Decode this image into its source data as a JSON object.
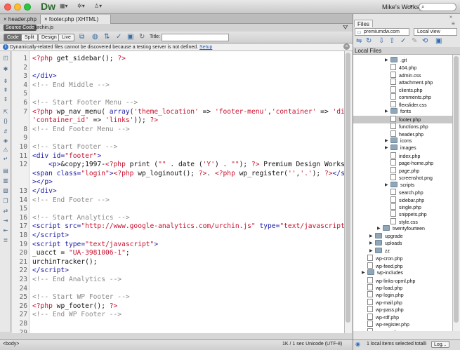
{
  "titlebar": {
    "app_logo": "Dw",
    "workspace": "Mike's Workspace",
    "search_placeholder": ""
  },
  "doc_tabs": [
    "header.php",
    "footer.php (XHTML)"
  ],
  "related": {
    "badge": "Source Code",
    "file": "urchin.js"
  },
  "view_buttons": [
    "Code",
    "Split",
    "Design",
    "Live"
  ],
  "title_label": "Title:",
  "info_bar": {
    "text": "Dynamically-related files cannot be discovered because a testing server is not defined.",
    "link": "Setup"
  },
  "code_lines": [
    {
      "n": "1",
      "html": "<span class='p'>&lt;?php</span> get_sidebar(); <span class='p'>?&gt;</span>"
    },
    {
      "n": "2",
      "html": ""
    },
    {
      "n": "3",
      "html": "<span class='t'>&lt;/div&gt;</span>"
    },
    {
      "n": "4",
      "html": "<span class='c'>&lt;!-- End Middle --&gt;</span>"
    },
    {
      "n": "5",
      "html": ""
    },
    {
      "n": "6",
      "html": "<span class='c'>&lt;!-- Start Footer Menu --&gt;</span>"
    },
    {
      "n": "7",
      "html": "<span class='p'>&lt;?php</span> wp_nav_menu( <span class='t'>array</span>(<span class='s'>'theme_location'</span> =&gt; <span class='s'>'footer-menu'</span>,<span class='s'>'container'</span> =&gt; <span class='s'>'div'</span>,"
    },
    {
      "n": "",
      "html": "<span class='s'>'container_id'</span> =&gt; <span class='s'>'links'</span>)); <span class='p'>?&gt;</span>"
    },
    {
      "n": "8",
      "html": "<span class='c'>&lt;!-- End Footer Menu --&gt;</span>"
    },
    {
      "n": "9",
      "html": ""
    },
    {
      "n": "10",
      "html": "<span class='c'>&lt;!-- Start Footer --&gt;</span>"
    },
    {
      "n": "11",
      "html": "<span class='t'>&lt;div</span> <span class='t'>id=</span><span class='s'>\"footer\"</span><span class='t'>&gt;</span>"
    },
    {
      "n": "12",
      "html": "    <span class='t'>&lt;p&gt;</span>&amp;copy;1997-<span class='p'>&lt;?php</span> print (<span class='s'>\"\"</span> . date (<span class='s'>'Y'</span>) . <span class='s'>\"\"</span>); <span class='p'>?&gt;</span> Premium Design Works."
    },
    {
      "n": "",
      "html": "<span class='t'>&lt;span</span> <span class='t'>class=</span><span class='s'>\"login\"</span><span class='t'>&gt;</span><span class='p'>&lt;?php</span> wp_loginout(); <span class='p'>?&gt;</span>. <span class='p'>&lt;?php</span> wp_register(<span class='s'>''</span>,<span class='s'>'.'</span>); <span class='p'>?&gt;</span><span class='t'>&lt;/span</span>"
    },
    {
      "n": "",
      "html": "<span class='t'>&gt;&lt;/p&gt;</span>"
    },
    {
      "n": "13",
      "html": "<span class='t'>&lt;/div&gt;</span>"
    },
    {
      "n": "14",
      "html": "<span class='c'>&lt;!-- End Footer --&gt;</span>"
    },
    {
      "n": "15",
      "html": ""
    },
    {
      "n": "16",
      "html": "<span class='c'>&lt;!-- Start Analytics --&gt;</span>"
    },
    {
      "n": "17",
      "html": "<span class='t'>&lt;script</span> <span class='t'>src=</span><span class='s'>\"http://www.google-analytics.com/urchin.js\"</span> <span class='t'>type=</span><span class='s'>\"text/javascript\"</span><span class='t'>&gt;</span>"
    },
    {
      "n": "18",
      "html": "<span class='t'>&lt;/script&gt;</span>"
    },
    {
      "n": "19",
      "html": "<span class='t'>&lt;script</span> <span class='t'>type=</span><span class='s'>\"text/javascript\"</span><span class='t'>&gt;</span>"
    },
    {
      "n": "20",
      "html": "_uacct = <span class='s'>\"UA-3981006-1\"</span>;"
    },
    {
      "n": "21",
      "html": "urchinTracker();"
    },
    {
      "n": "22",
      "html": "<span class='t'>&lt;/script&gt;</span>"
    },
    {
      "n": "23",
      "html": "<span class='c'>&lt;!-- End Analytics --&gt;</span>"
    },
    {
      "n": "24",
      "html": ""
    },
    {
      "n": "25",
      "html": "<span class='c'>&lt;!-- Start WP Footer --&gt;</span>"
    },
    {
      "n": "26",
      "html": "<span class='p'>&lt;?php</span> wp_footer(); <span class='p'>?&gt;</span>"
    },
    {
      "n": "27",
      "html": "<span class='c'>&lt;!-- End WP Footer --&gt;</span>"
    },
    {
      "n": "28",
      "html": ""
    },
    {
      "n": "29",
      "html": ""
    },
    {
      "n": "30",
      "html": "<span class='t'>&lt;/body&gt;</span>"
    },
    {
      "n": "31",
      "html": "<span class='t'>&lt;/html&gt;</span>"
    },
    {
      "n": "32",
      "html": ""
    }
  ],
  "status": {
    "tag": "<body>",
    "info": "1K / 1 sec  Unicode (UTF-8)"
  },
  "files_panel": {
    "tab": "Files",
    "site": "premiumdw.com",
    "view": "Local view",
    "header": "Local Files",
    "items": [
      {
        "label": ".git",
        "type": "folder",
        "depth": 3,
        "arrow": true
      },
      {
        "label": "404.php",
        "type": "file",
        "depth": 3
      },
      {
        "label": "admin.css",
        "type": "file",
        "depth": 3
      },
      {
        "label": "attachment.php",
        "type": "file",
        "depth": 3
      },
      {
        "label": "clients.php",
        "type": "file",
        "depth": 3
      },
      {
        "label": "comments.php",
        "type": "file",
        "depth": 3
      },
      {
        "label": "flexslider.css",
        "type": "file",
        "depth": 3
      },
      {
        "label": "fonts",
        "type": "folder",
        "depth": 3,
        "arrow": true
      },
      {
        "label": "footer.php",
        "type": "file",
        "depth": 3,
        "selected": true
      },
      {
        "label": "functions.php",
        "type": "file",
        "depth": 3
      },
      {
        "label": "header.php",
        "type": "file",
        "depth": 3
      },
      {
        "label": "icons",
        "type": "folder",
        "depth": 3,
        "arrow": true
      },
      {
        "label": "images",
        "type": "folder",
        "depth": 3,
        "arrow": true
      },
      {
        "label": "index.php",
        "type": "file",
        "depth": 3
      },
      {
        "label": "page-home.php",
        "type": "file",
        "depth": 3
      },
      {
        "label": "page.php",
        "type": "file",
        "depth": 3
      },
      {
        "label": "screenshot.png",
        "type": "file",
        "depth": 3
      },
      {
        "label": "scripts",
        "type": "folder",
        "depth": 3,
        "arrow": true
      },
      {
        "label": "search.php",
        "type": "file",
        "depth": 3
      },
      {
        "label": "sidebar.php",
        "type": "file",
        "depth": 3
      },
      {
        "label": "single.php",
        "type": "file",
        "depth": 3
      },
      {
        "label": "snippets.php",
        "type": "file",
        "depth": 3
      },
      {
        "label": "style.css",
        "type": "file",
        "depth": 3
      },
      {
        "label": "twentyfourteen",
        "type": "folder",
        "depth": 2,
        "arrow": true
      },
      {
        "label": "upgrade",
        "type": "folder",
        "depth": 1,
        "arrow": true
      },
      {
        "label": "uploads",
        "type": "folder",
        "depth": 1,
        "arrow": true
      },
      {
        "label": "zz",
        "type": "folder",
        "depth": 1,
        "arrow": true
      },
      {
        "label": "wp-cron.php",
        "type": "file",
        "depth": 0
      },
      {
        "label": "wp-feed.php",
        "type": "file",
        "depth": 0
      },
      {
        "label": "wp-includes",
        "type": "folder",
        "depth": 0,
        "arrow": true
      },
      {
        "label": "wp-links-opml.php",
        "type": "file",
        "depth": 0
      },
      {
        "label": "wp-load.php",
        "type": "file",
        "depth": 0
      },
      {
        "label": "wp-login.php",
        "type": "file",
        "depth": 0
      },
      {
        "label": "wp-mail.php",
        "type": "file",
        "depth": 0
      },
      {
        "label": "wp-pass.php",
        "type": "file",
        "depth": 0
      },
      {
        "label": "wp-rdf.php",
        "type": "file",
        "depth": 0
      },
      {
        "label": "wp-register.php",
        "type": "file",
        "depth": 0
      },
      {
        "label": "wp-rss.php",
        "type": "file",
        "depth": 0
      }
    ],
    "status": "1 local items selected totalli",
    "log_button": "Log..."
  },
  "colors": {
    "accent": "#3a74c4",
    "php": "#c8102e",
    "tag": "#1a1aa8",
    "comment": "#8a8a8a"
  }
}
